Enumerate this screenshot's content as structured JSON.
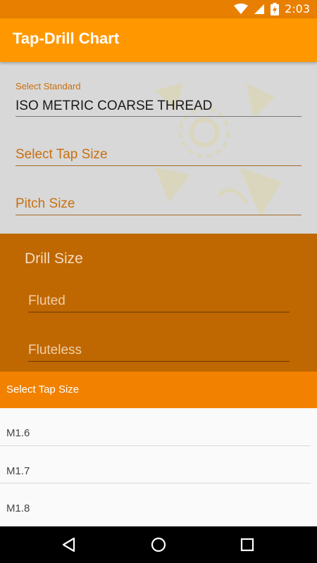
{
  "status_bar": {
    "time": "2:03",
    "icons": [
      "wifi-icon",
      "signal-icon",
      "battery-icon"
    ]
  },
  "app_bar": {
    "title": "Tap-Drill Chart",
    "color": "#ff9800"
  },
  "form": {
    "standard_label": "Select Standard",
    "standard_value": "ISO METRIC COARSE THREAD",
    "tap_size_placeholder": "Select Tap Size",
    "pitch_placeholder": "Pitch Size"
  },
  "drill": {
    "title": "Drill Size",
    "fluted_placeholder": "Fluted",
    "fluteless_placeholder": "Fluteless",
    "color": "#bf6700"
  },
  "dropdown": {
    "title": "Select Tap Size",
    "items": [
      {
        "label": "M1.6"
      },
      {
        "label": "M1.7"
      },
      {
        "label": "M1.8"
      }
    ]
  },
  "nav_bar": {
    "buttons": [
      "back-icon",
      "home-icon",
      "recents-icon"
    ]
  }
}
